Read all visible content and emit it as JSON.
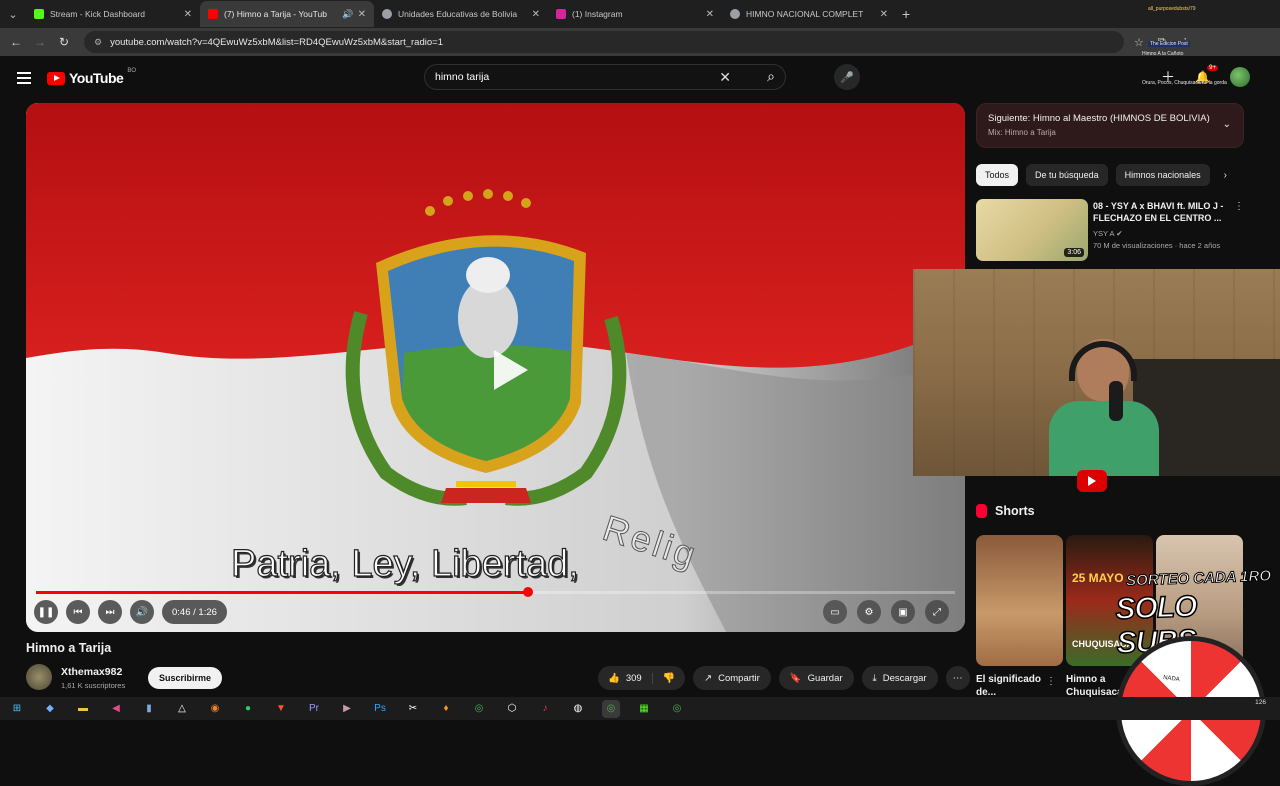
{
  "browser": {
    "tabs": [
      {
        "label": "Stream - Kick Dashboard",
        "color": "#53fc18"
      },
      {
        "label": "(7) Himno a Tarija - YouTub",
        "color": "#ff0000",
        "active": true
      },
      {
        "label": "Unidades Educativas de Bolivia",
        "color": "#9aa0a6"
      },
      {
        "label": "(1) Instagram",
        "color": "#d6249f"
      },
      {
        "label": "HIMNO NACIONAL COMPLET",
        "color": "#9aa0a6"
      }
    ],
    "url": "youtube.com/watch?v=4QEwuWz5xbM&list=RD4QEwuWz5xbM&start_radio=1"
  },
  "overlay_notes": {
    "note1": "all_purposedubsts/79",
    "note2": "The Edicion Post",
    "note3": "Himno A la Cañoto",
    "note4": "Orura, Pocos, Chuquisaca fui la gorda"
  },
  "header": {
    "logo_text": "YouTube",
    "country_code": "BO",
    "search_value": "himno tarija",
    "notification_count": "9+",
    "brand_red": "#ff0000"
  },
  "player": {
    "lyric": "Patria, Ley, Libertad,",
    "lyric_ghost": "Relig",
    "time": "0:46 / 1:26",
    "progress_fraction": 0.535,
    "progress_color": "#ff0000"
  },
  "video": {
    "title": "Himno a Tarija",
    "channel": "Xthemax982",
    "subscribers": "1,61 K suscriptores",
    "subscribe_label": "Suscribirme",
    "likes": "309",
    "share_label": "Compartir",
    "save_label": "Guardar",
    "download_label": "Descargar"
  },
  "sidebar": {
    "next_title": "Siguiente: Himno al Maestro (HIMNOS DE BOLIVIA)",
    "next_sub": "Mix: Himno a Tarija",
    "chips": [
      "Todos",
      "De tu búsqueda",
      "Himnos nacionales"
    ],
    "rec": {
      "title": "08 - YSY A x BHAVI ft. MILO J - FLECHAZO EN EL CENTRO ...",
      "channel": "YSY A",
      "meta": "70 M de visualizaciones · hace 2 años",
      "duration": "3:06"
    },
    "shorts_label": "Shorts",
    "shorts": [
      {
        "caption": "El significado de..."
      },
      {
        "caption": "Himno a Chuquisaca"
      }
    ],
    "short2_big": "25 MAYO",
    "short2_sub": "CHUQUISACA",
    "promo_line1": "SORTEO CADA 1RO",
    "promo_line2": "SOLO SUBS",
    "wheel_label": "NADA"
  },
  "taskbar": {
    "clock": "126"
  }
}
